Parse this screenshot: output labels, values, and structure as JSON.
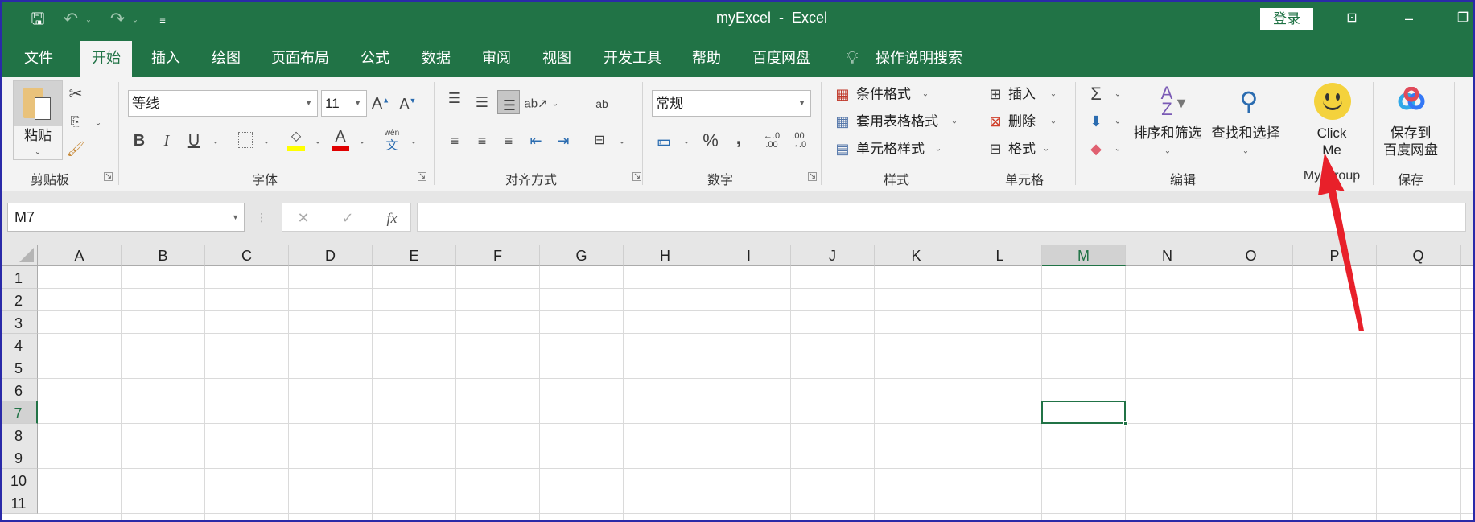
{
  "window": {
    "title": "myExcel  -  Excel",
    "login_label": "登录"
  },
  "tabs": [
    "文件",
    "开始",
    "插入",
    "绘图",
    "页面布局",
    "公式",
    "数据",
    "审阅",
    "视图",
    "开发工具",
    "帮助",
    "百度网盘"
  ],
  "active_tab": "开始",
  "tell_me": {
    "label": "操作说明搜索",
    "icon": "lightbulb-icon"
  },
  "clipboard": {
    "paste": "粘贴",
    "label": "剪贴板"
  },
  "font": {
    "name": "等线",
    "size": "11",
    "label": "字体",
    "bold": "B",
    "italic": "I",
    "underline": "U",
    "phonetic_top": "wén",
    "phonetic": "文",
    "grow": "A",
    "shrink": "A",
    "color": "A",
    "fill_color": "#ffff00",
    "font_color": "#e00000"
  },
  "alignment": {
    "label": "对齐方式",
    "wrap": "ab"
  },
  "number": {
    "format": "常规",
    "label": "数字",
    "percent": "%",
    "comma": ",",
    "inc": "←.0\n.00",
    "dec": ".00\n→.0"
  },
  "styles": {
    "label": "样式",
    "items": [
      "条件格式",
      "套用表格格式",
      "单元格样式"
    ]
  },
  "cells": {
    "label": "单元格",
    "items": [
      "插入",
      "删除",
      "格式"
    ]
  },
  "editing": {
    "label": "编辑",
    "sort": "排序和筛选",
    "find": "查找和选择",
    "sum": "Σ"
  },
  "mygroup": {
    "label": "My Group",
    "button_line1": "Click",
    "button_line2": "Me"
  },
  "save": {
    "label": "保存",
    "button_line1": "保存到",
    "button_line2": "百度网盘"
  },
  "formula_bar": {
    "name_box": "M7",
    "formula": "",
    "fx": "fx",
    "cancel": "✕",
    "enter": "✓"
  },
  "sheet": {
    "columns": [
      "A",
      "B",
      "C",
      "D",
      "E",
      "F",
      "G",
      "H",
      "I",
      "J",
      "K",
      "L",
      "M",
      "N",
      "O",
      "P",
      "Q"
    ],
    "rows": [
      "1",
      "2",
      "3",
      "4",
      "5",
      "6",
      "7",
      "8",
      "9",
      "10",
      "11"
    ],
    "selected_cell": "M7",
    "selected_col": "M",
    "selected_row": "7"
  },
  "colors": {
    "accent": "#217346",
    "annotation_arrow": "#e8202a"
  }
}
